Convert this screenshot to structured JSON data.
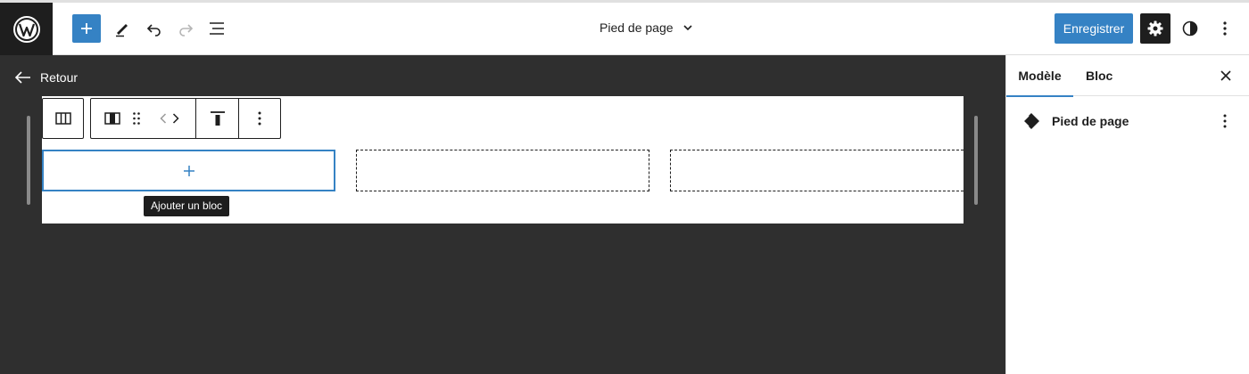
{
  "topbar": {
    "title": "Pied de page",
    "save_label": "Enregistrer",
    "icons": [
      "wordpress-logo-icon",
      "plus-icon",
      "pencil-icon",
      "undo-icon",
      "redo-icon",
      "list-view-icon",
      "chevron-down-icon",
      "gear-icon",
      "half-circle-icon",
      "kebab-icon"
    ]
  },
  "canvas": {
    "back_label": "Retour",
    "toolbar_icons": [
      "columns-icon",
      "column-icon",
      "drag-handle-icon",
      "chevron-left-icon",
      "chevron-right-icon",
      "align-top-icon",
      "kebab-icon"
    ],
    "add_block_tooltip": "Ajouter un bloc"
  },
  "sidebar": {
    "tabs": [
      {
        "label": "Modèle",
        "active": true
      },
      {
        "label": "Bloc",
        "active": false
      }
    ],
    "part_name": "Pied de page"
  },
  "colors": {
    "accent": "#3582c4",
    "dark": "#1e1e1e",
    "canvas_bg": "#2f2f2f"
  }
}
